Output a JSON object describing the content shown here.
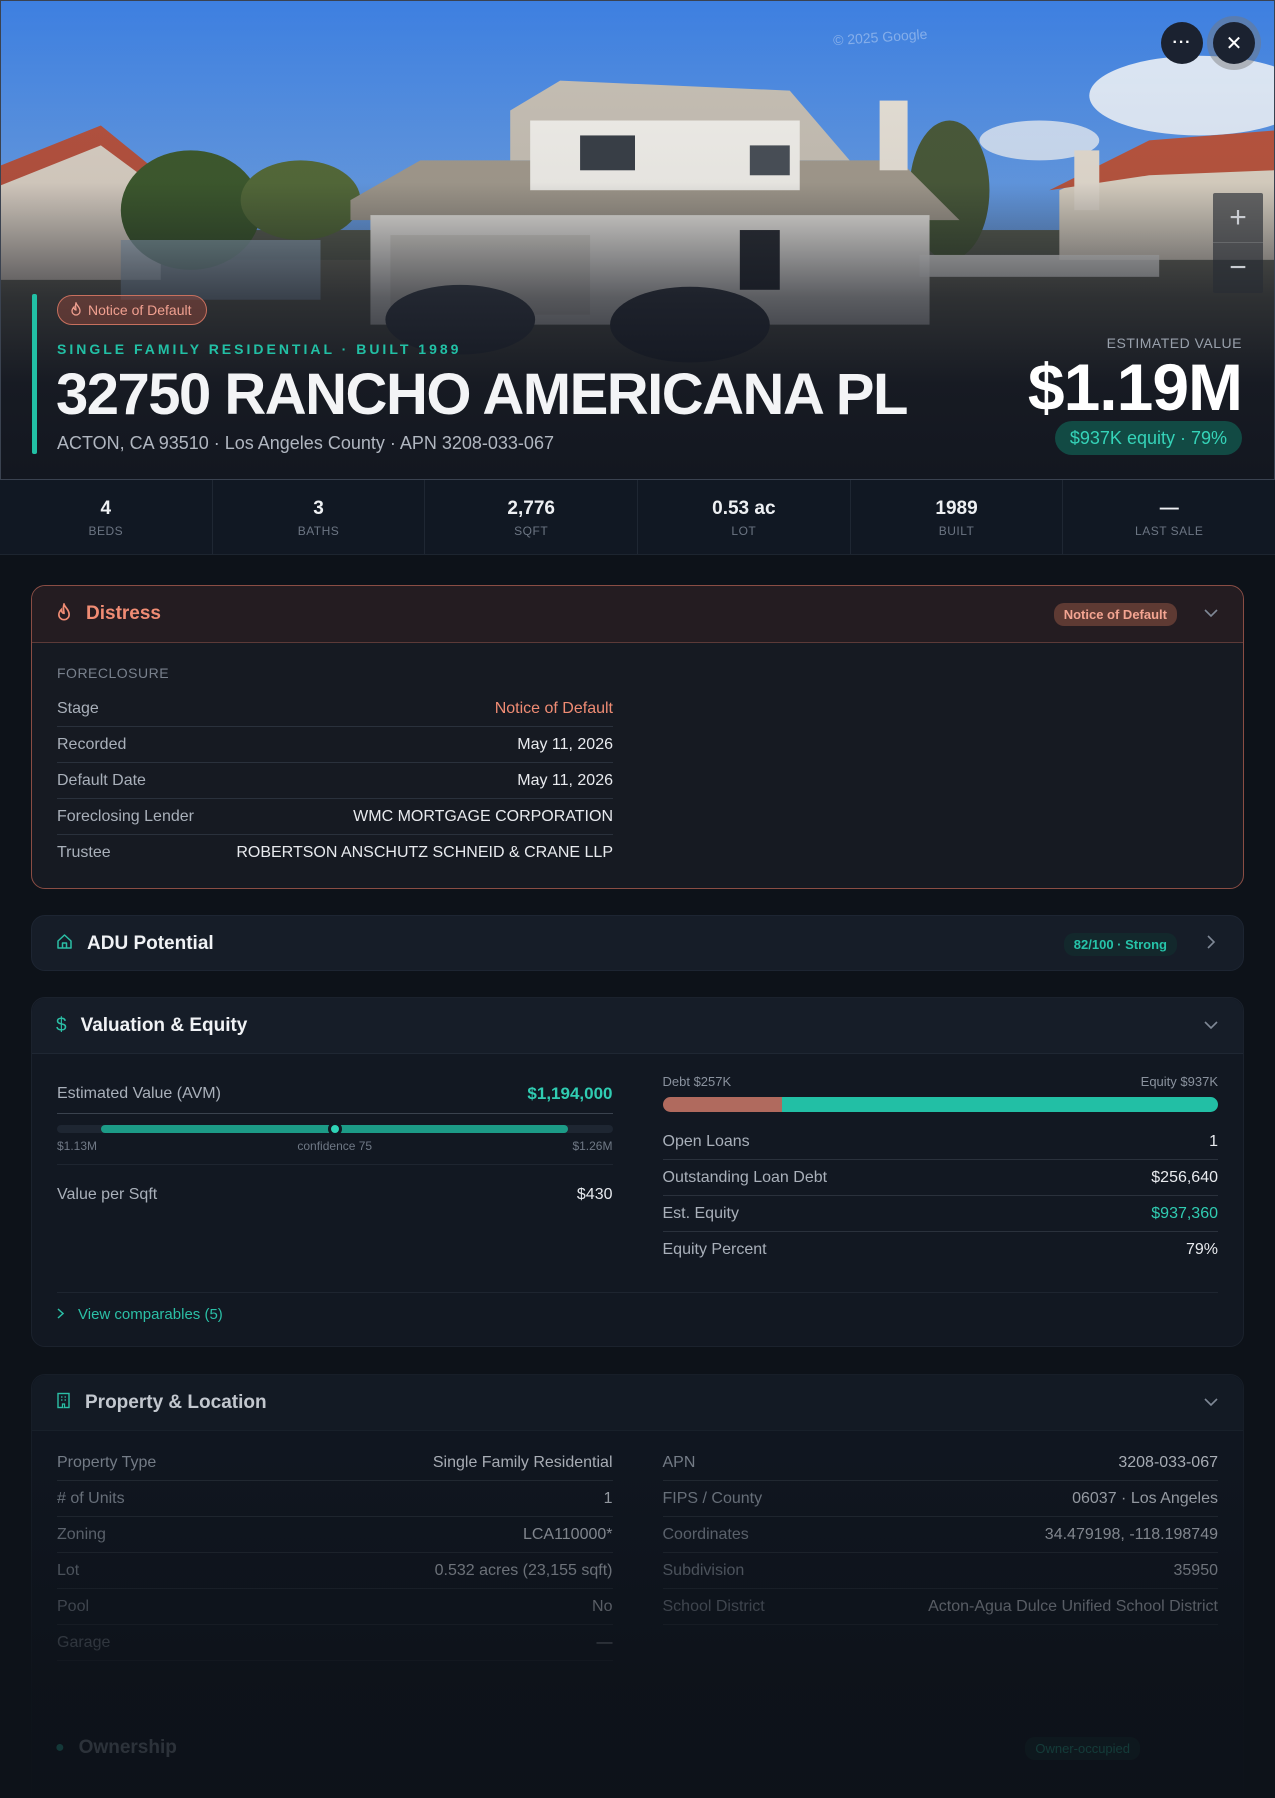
{
  "hero": {
    "watermark": "© 2025 Google",
    "distress_badge": "Notice of Default",
    "property_type": "SINGLE FAMILY RESIDENTIAL · BUILT 1989",
    "address": "32750 RANCHO AMERICANA PL",
    "sub_address": "ACTON, CA 93510 · Los Angeles County · APN 3208-033-067",
    "estimated_label": "ESTIMATED VALUE",
    "estimated_value": "$1.19M",
    "equity_pill": "$937K equity · 79%",
    "more_icon": "···",
    "close_icon": "✕",
    "zoom_in": "+",
    "zoom_out": "−"
  },
  "stats": [
    {
      "value": "4",
      "label": "BEDS"
    },
    {
      "value": "3",
      "label": "BATHS"
    },
    {
      "value": "2,776",
      "label": "SQFT"
    },
    {
      "value": "0.53 ac",
      "label": "LOT"
    },
    {
      "value": "1989",
      "label": "BUILT"
    },
    {
      "value": "—",
      "label": "LAST SALE"
    }
  ],
  "distress": {
    "title": "Distress",
    "badge": "Notice of Default",
    "section": "FORECLOSURE",
    "rows": [
      {
        "k": "Stage",
        "v": "Notice of Default"
      },
      {
        "k": "Recorded",
        "v": "May 11, 2026"
      },
      {
        "k": "Default Date",
        "v": "May 11, 2026"
      },
      {
        "k": "Foreclosing Lender",
        "v": "WMC MORTGAGE CORPORATION"
      },
      {
        "k": "Trustee",
        "v": "ROBERTSON ANSCHUTZ SCHNEID & CRANE LLP"
      }
    ]
  },
  "adu": {
    "title": "ADU Potential",
    "score": "82/100 · Strong"
  },
  "valuation": {
    "title": "Valuation & Equity",
    "avm_label": "Estimated Value (AVM)",
    "avm_value": "$1,194,000",
    "range_low": "$1.13M",
    "confidence": "confidence 75",
    "range_high": "$1.26M",
    "confidence_position": 0.5,
    "vps_label": "Value per Sqft",
    "vps_value": "$430",
    "debt_label": "Debt $257K",
    "equity_label": "Equity $937K",
    "equity_fraction": 0.785,
    "rows": [
      {
        "k": "Open Loans",
        "v": "1"
      },
      {
        "k": "Outstanding Loan Debt",
        "v": "$256,640"
      },
      {
        "k": "Est. Equity",
        "v": "$937,360"
      },
      {
        "k": "Equity Percent",
        "v": "79%"
      }
    ],
    "comps": "View comparables (5)"
  },
  "property": {
    "title": "Property & Location",
    "left": [
      {
        "k": "Property Type",
        "v": "Single Family Residential"
      },
      {
        "k": "# of Units",
        "v": "1"
      },
      {
        "k": "Zoning",
        "v": "LCA110000*"
      },
      {
        "k": "Lot",
        "v": "0.532 acres (23,155 sqft)"
      },
      {
        "k": "Pool",
        "v": "No"
      },
      {
        "k": "Garage",
        "v": "—"
      }
    ],
    "right": [
      {
        "k": "APN",
        "v": "3208-033-067"
      },
      {
        "k": "FIPS / County",
        "v": "06037 · Los Angeles"
      },
      {
        "k": "Coordinates",
        "v": "34.479198, -118.198749"
      },
      {
        "k": "Subdivision",
        "v": "35950"
      },
      {
        "k": "School District",
        "v": "Acton-Agua Dulce Unified School District"
      }
    ]
  },
  "ownership": {
    "title": "Ownership",
    "badge": "Owner-occupied"
  }
}
